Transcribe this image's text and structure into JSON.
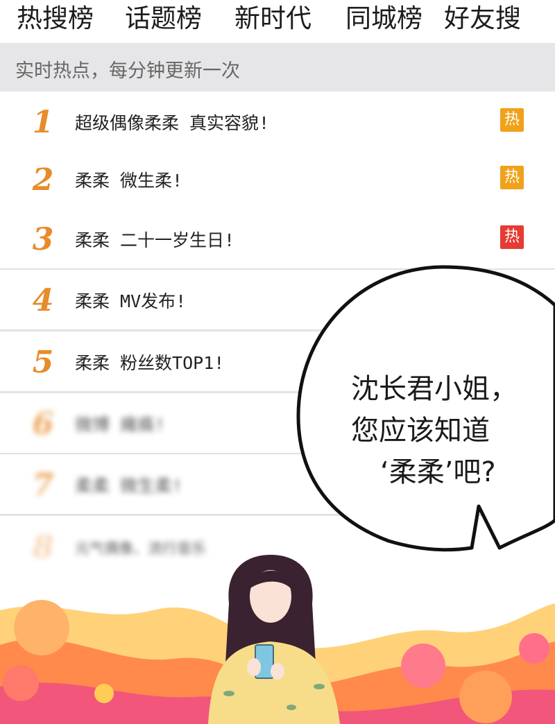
{
  "tabs": [
    {
      "label": "热搜榜"
    },
    {
      "label": "话题榜"
    },
    {
      "label": "新时代"
    },
    {
      "label": "同城榜"
    },
    {
      "label": "好友搜"
    }
  ],
  "subtitle": "实时热点，每分钟更新一次",
  "list": [
    {
      "rank": "1",
      "title": "超级偶像柔柔 真实容貌!",
      "badge": "热",
      "badge_color": "#f0a21b"
    },
    {
      "rank": "2",
      "title": "柔柔 微生柔!",
      "badge": "热",
      "badge_color": "#f0a21b"
    },
    {
      "rank": "3",
      "title": "柔柔 二十一岁生日!",
      "badge": "热",
      "badge_color": "#e63b32"
    },
    {
      "rank": "4",
      "title": "柔柔 MV发布!"
    },
    {
      "rank": "5",
      "title": "柔柔 粉丝数TOP1!"
    },
    {
      "rank": "6",
      "title": "微博 瘫痪!"
    },
    {
      "rank": "7",
      "title": "柔柔 微生柔!"
    },
    {
      "rank": "8",
      "title": "元气偶像、流行音乐"
    }
  ],
  "speech": {
    "line1": "沈长君小姐，",
    "line2": "您应该知道",
    "line3": "‘柔柔’吧?"
  },
  "colors": {
    "rank_orange": "#e88b2a",
    "hot_orange": "#f0a21b",
    "hot_red": "#e63b32",
    "subbar_bg": "#e6e6e8"
  }
}
